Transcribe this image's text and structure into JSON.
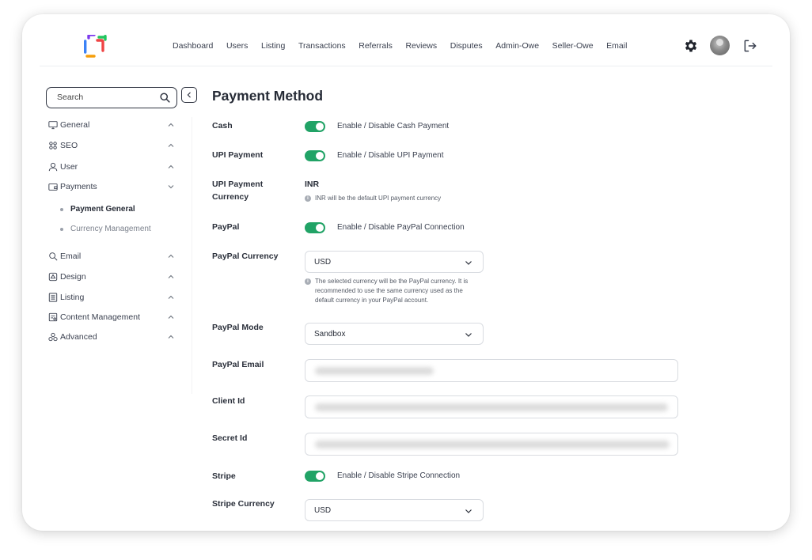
{
  "nav": {
    "items": [
      "Dashboard",
      "Users",
      "Listing",
      "Transactions",
      "Referrals",
      "Reviews",
      "Disputes",
      "Admin-Owe",
      "Seller-Owe",
      "Email"
    ]
  },
  "sidebar": {
    "search_placeholder": "Search",
    "items": [
      {
        "label": "General",
        "icon": "monitor-icon",
        "chevron": "up"
      },
      {
        "label": "SEO",
        "icon": "seo-icon",
        "chevron": "up"
      },
      {
        "label": "User",
        "icon": "user-icon",
        "chevron": "up"
      },
      {
        "label": "Payments",
        "icon": "wallet-icon",
        "chevron": "down"
      },
      {
        "label": "Email",
        "icon": "email-icon",
        "chevron": "up"
      },
      {
        "label": "Design",
        "icon": "design-icon",
        "chevron": "up"
      },
      {
        "label": "Listing",
        "icon": "listing-icon",
        "chevron": "up"
      },
      {
        "label": "Content Management",
        "icon": "content-icon",
        "chevron": "up"
      },
      {
        "label": "Advanced",
        "icon": "advanced-icon",
        "chevron": "up"
      }
    ],
    "subitems": [
      {
        "label": "Payment General",
        "active": true
      },
      {
        "label": "Currency Management",
        "active": false
      }
    ]
  },
  "main": {
    "title": "Payment Method",
    "cash": {
      "label": "Cash",
      "toggle_text": "Enable / Disable Cash Payment",
      "enabled": true
    },
    "upi": {
      "label": "UPI Payment",
      "toggle_text": "Enable / Disable UPI Payment",
      "enabled": true
    },
    "upi_currency": {
      "label_line1": "UPI Payment",
      "label_line2": "Currency",
      "value": "INR",
      "hint": "INR will be the default UPI payment currency"
    },
    "paypal": {
      "label": "PayPal",
      "toggle_text": "Enable / Disable PayPal Connection",
      "enabled": true
    },
    "paypal_currency": {
      "label": "PayPal Currency",
      "value": "USD",
      "hint_line1": "The selected currency will be the PayPal currency. It is",
      "hint_line2": "recommended to use the same currency used as the",
      "hint_line3": "default currency in your PayPal account."
    },
    "paypal_mode": {
      "label": "PayPal Mode",
      "value": "Sandbox"
    },
    "paypal_email": {
      "label": "PayPal Email"
    },
    "client_id": {
      "label": "Client Id"
    },
    "secret_id": {
      "label": "Secret Id"
    },
    "stripe": {
      "label": "Stripe",
      "toggle_text": "Enable / Disable Stripe Connection",
      "enabled": true
    },
    "stripe_currency": {
      "label": "Stripe Currency",
      "value": "USD"
    }
  },
  "colors": {
    "toggle_on": "#21a366",
    "logo": [
      "#7c3aed",
      "#3b82f6",
      "#22c55e",
      "#f59e0b",
      "#ef4444"
    ]
  }
}
